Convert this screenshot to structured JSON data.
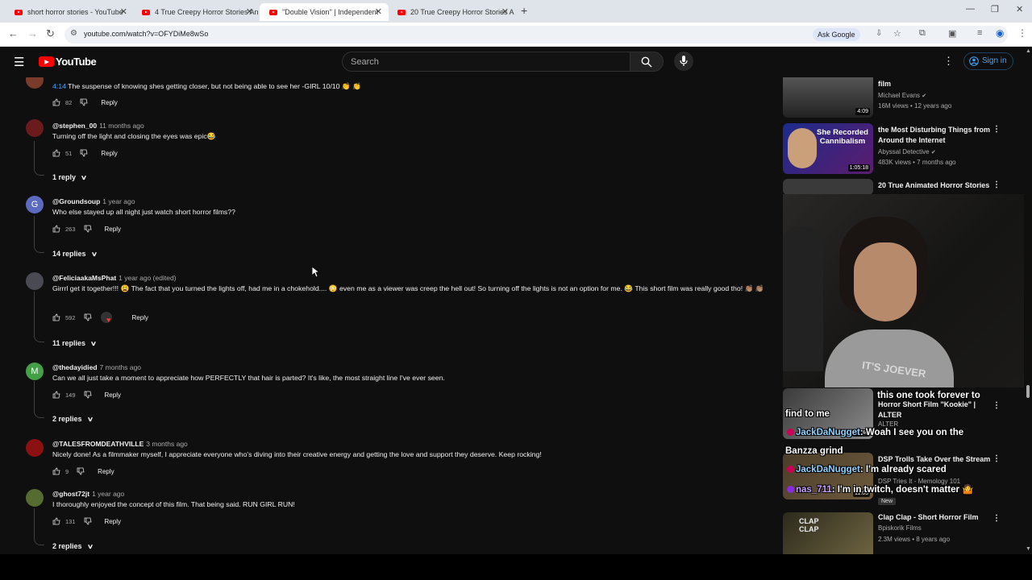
{
  "browser": {
    "tabs": [
      {
        "label": "short horror stories - YouTube",
        "active": false
      },
      {
        "label": "4 True Creepy Horror Stories An",
        "active": false
      },
      {
        "label": "\"Double Vision\" | Independent",
        "active": true
      },
      {
        "label": "20 True Creepy Horror Stories A",
        "active": false
      }
    ],
    "url": "youtube.com/watch?v=OFYDiMe8wSo",
    "ask_google": "Ask Google"
  },
  "youtube": {
    "logo": "YouTube",
    "search_placeholder": "Search",
    "sign_in": "Sign in"
  },
  "comments": [
    {
      "author": "",
      "time": "",
      "timestamp_link": "4:14",
      "text": " The suspense of knowing shes getting closer, but not being able to see her -GIRL 10/10 👏 👏",
      "likes": "82",
      "reply": "Reply",
      "replies": ""
    },
    {
      "author": "@stephen_00",
      "time": "11 months ago",
      "timestamp_link": "",
      "text": "Turning off the light and closing the eyes was epic😂",
      "likes": "51",
      "reply": "Reply",
      "replies": "1 reply"
    },
    {
      "author": "@Groundsoup",
      "time": "1 year ago",
      "timestamp_link": "",
      "text": "Who else stayed up all night just watch short horror films??",
      "likes": "263",
      "reply": "Reply",
      "replies": "14 replies",
      "avatar_letter": "G"
    },
    {
      "author": "@FeliciaakaMsPhat",
      "time": "1 year ago (edited)",
      "timestamp_link": "",
      "text": "Girrrl get it together!!! 😩  The fact that you turned the lights off, had me in a chokehold.... 😳  even me as a viewer was creep the hell out! So turning off the lights is not an option for me. 😂  This short film was really good tho! 👏🏽 👏🏽",
      "likes": "592",
      "reply": "Reply",
      "replies": "11 replies"
    },
    {
      "author": "@thedayidied",
      "time": "7 months ago",
      "timestamp_link": "",
      "text": "Can we all just take a moment to appreciate how PERFECTLY that hair is parted? It's like, the most straight line I've ever seen.",
      "likes": "149",
      "reply": "Reply",
      "replies": "2 replies",
      "avatar_letter": "M"
    },
    {
      "author": "@TALESFROMDEATHVILLE",
      "time": "3 months ago",
      "timestamp_link": "",
      "text": "Nicely done! As a filmmaker myself, I appreciate everyone who's diving into their creative energy and getting the love and support they deserve. Keep rocking!",
      "likes": "9",
      "reply": "Reply",
      "replies": ""
    },
    {
      "author": "@ghost72jt",
      "time": "1 year ago",
      "timestamp_link": "",
      "text": "I thoroughly enjoyed the concept of this film. That being said. RUN GIRL RUN!",
      "likes": "131",
      "reply": "Reply",
      "replies": "2 replies"
    }
  ],
  "sidebar": [
    {
      "title": "film",
      "channel": "Michael Evans",
      "meta": "16M views • 12 years ago",
      "duration": "4:09"
    },
    {
      "title": "the Most Disturbing Things from Around the Internet",
      "channel": "Abyssal Detective",
      "meta": "483K views • 7 months ago",
      "duration": "1:05:18",
      "thumb_text": "She Recorded Cannibalism"
    },
    {
      "title": "20 True Animated Horror Stories",
      "channel": "",
      "meta": "",
      "duration": ""
    },
    {
      "title": "Horror Short Film \"Kookie\" | ALTER",
      "channel": "ALTER",
      "meta": "",
      "duration": "12:40"
    },
    {
      "title": "DSP Trolls Take Over the Stream",
      "channel": "DSP Tries It - Memology 101",
      "meta": "",
      "duration": "11:05",
      "badge": "New"
    },
    {
      "title": "Clap Clap - Short Horror Film",
      "channel": "Bpiskorik Films",
      "meta": "2.3M views • 8 years ago",
      "duration": "",
      "thumb_text": "CLAP CLAP"
    }
  ],
  "webcam": {
    "shirt_text": "IT'S JOEVER"
  },
  "chat_overlay": [
    {
      "name": "",
      "message": "this one took forever to"
    },
    {
      "name": "",
      "message": "find to me"
    },
    {
      "name": "JackDaNugget",
      "message": ": Woah I see you on the"
    },
    {
      "name": "",
      "message": "Banzza grind"
    },
    {
      "name": "JackDaNugget",
      "message": ": I'm already scared"
    },
    {
      "name": "nas_711",
      "message": ": I'm in twitch, doesn't matter 🤷"
    }
  ],
  "colors": {
    "yt_bg": "#0f0f0f",
    "yt_red": "#ff0000",
    "link_blue": "#3ea6ff",
    "tabbar": "#dfe3ea"
  }
}
